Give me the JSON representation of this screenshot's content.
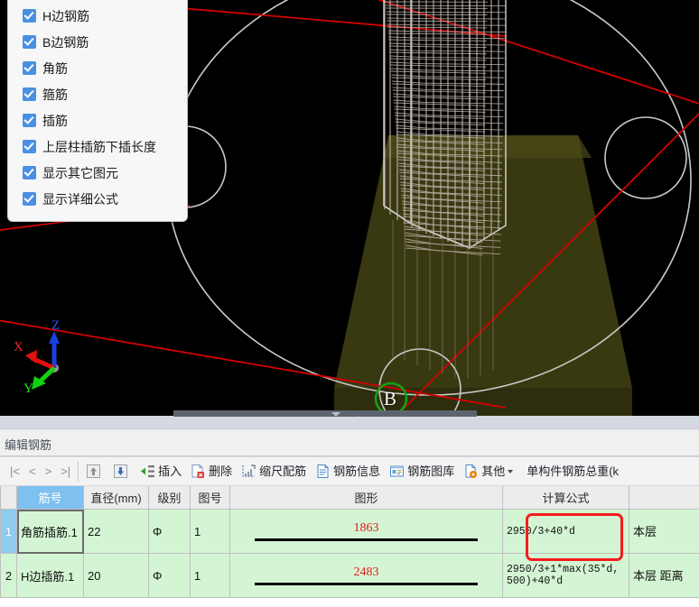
{
  "options_panel": {
    "name": "rebar-display-options",
    "items": [
      {
        "label": "H边钢筋",
        "checked": true
      },
      {
        "label": "B边钢筋",
        "checked": true
      },
      {
        "label": "角筋",
        "checked": true
      },
      {
        "label": "箍筋",
        "checked": true
      },
      {
        "label": "插筋",
        "checked": true
      },
      {
        "label": "上层柱插筋下插长度",
        "checked": true
      },
      {
        "label": "显示其它图元",
        "checked": true
      },
      {
        "label": "显示详细公式",
        "checked": true
      }
    ]
  },
  "viewport": {
    "axis_gizmo": {
      "x_label": "X",
      "y_label": "Y",
      "z_label": "Z"
    },
    "annotation_label": "B",
    "colors": {
      "background": "#000000",
      "rebar": "#cfc3bd",
      "slab": "#3a3a12",
      "guide_red": "#d40000",
      "guide_white": "#c9c9c9",
      "marker_green": "#14a014"
    }
  },
  "panel": {
    "title": "编辑钢筋"
  },
  "toolbar": {
    "nav": [
      {
        "label": "|<",
        "name": "first-record"
      },
      {
        "label": "<",
        "name": "prev-record"
      },
      {
        "label": ">",
        "name": "next-record"
      },
      {
        "label": ">|",
        "name": "last-record"
      }
    ],
    "items": [
      {
        "label": "",
        "icon": "move-up-icon",
        "name": "move-up"
      },
      {
        "label": "",
        "icon": "move-down-icon",
        "name": "move-down"
      },
      {
        "label": "插入",
        "icon": "insert-row-icon",
        "name": "insert-row"
      },
      {
        "label": "删除",
        "icon": "delete-row-icon",
        "name": "delete-row"
      },
      {
        "label": "缩尺配筋",
        "icon": "scale-rebar-icon",
        "name": "scale-rebar"
      },
      {
        "label": "钢筋信息",
        "icon": "rebar-info-icon",
        "name": "rebar-info"
      },
      {
        "label": "钢筋图库",
        "icon": "rebar-library-icon",
        "name": "rebar-library"
      },
      {
        "label": "其他",
        "icon": "other-settings-icon",
        "name": "other-menu",
        "has_caret": true
      }
    ],
    "total_weight_label": "单构件钢筋总重(k"
  },
  "grid": {
    "columns": [
      {
        "key": "jinhao",
        "label": "筋号",
        "selected": true
      },
      {
        "key": "zhijing",
        "label": "直径(mm)"
      },
      {
        "key": "jibie",
        "label": "级别"
      },
      {
        "key": "tuhao",
        "label": "图号"
      },
      {
        "key": "tuxing",
        "label": "图形"
      },
      {
        "key": "gongshi",
        "label": "计算公式"
      },
      {
        "key": "shuoming",
        "label": ""
      }
    ],
    "rows": [
      {
        "num": "1",
        "active": true,
        "jinhao": "角筋插筋.1",
        "zhijing": "22",
        "jibie": "Φ",
        "tuhao": "1",
        "shape_value": "1863",
        "gongshi": "2950/3+40*d",
        "shuoming": "本层",
        "formula_highlighted": true
      },
      {
        "num": "2",
        "active": false,
        "jinhao": "H边插筋.1",
        "zhijing": "20",
        "jibie": "Φ",
        "tuhao": "1",
        "shape_value": "2483",
        "gongshi": "2950/3+1*max(35*d,500)+40*d",
        "shuoming": "本层\n距离",
        "formula_highlighted": false
      }
    ],
    "highlight_color": "#f41c1c"
  }
}
